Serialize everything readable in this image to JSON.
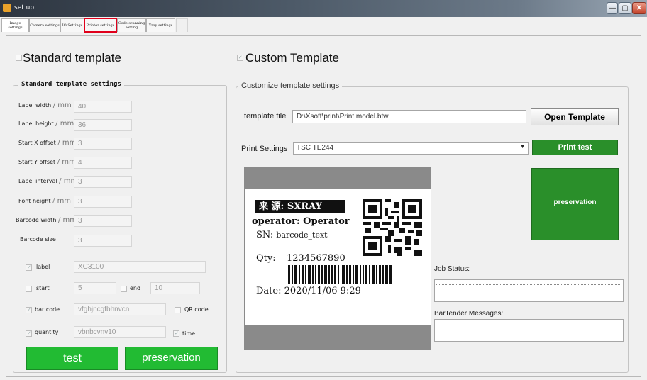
{
  "window": {
    "title": "set up"
  },
  "titlebar_buttons": {
    "minimize": "—",
    "maximize": "▢",
    "close": "✕"
  },
  "tabs": [
    {
      "label": "Image settings"
    },
    {
      "label": "Camera settings"
    },
    {
      "label": "IO Settings"
    },
    {
      "label": "Printer settings"
    },
    {
      "label": "Code scanning setting"
    },
    {
      "label": "Xray settings"
    }
  ],
  "standard": {
    "radio_label": "Standard template",
    "group_title": "Standard template settings",
    "fields": [
      {
        "label": "Label width",
        "unit": "/ mm",
        "value": "40"
      },
      {
        "label": "Label height",
        "unit": "/ mm",
        "value": "36"
      },
      {
        "label": "Start X offset",
        "unit": "/ mm",
        "value": "3"
      },
      {
        "label": "Start Y offset",
        "unit": "/ mm",
        "value": "4"
      },
      {
        "label": "Label interval",
        "unit": "/ mm",
        "value": "3"
      },
      {
        "label": "Font height",
        "unit": "/ mm",
        "value": "3"
      },
      {
        "label": "Barcode width",
        "unit": "/ mm",
        "value": "3"
      },
      {
        "label": "Barcode size",
        "unit": "",
        "value": "3"
      }
    ],
    "checks": {
      "label": {
        "text": "label",
        "value": "XC3100"
      },
      "start": {
        "text": "start",
        "value": "5"
      },
      "end": {
        "text": "end",
        "value": "10"
      },
      "bar_code": {
        "text": "bar code",
        "value": "vfghjncgfbhnvcn"
      },
      "qr_code": {
        "text": "QR code"
      },
      "quantity": {
        "text": "quantity",
        "value": "vbnbcvnv10"
      },
      "time": {
        "text": "time"
      }
    },
    "test_button": "test",
    "save_button": "preservation"
  },
  "custom": {
    "radio_label": "Custom Template",
    "group_title": "Customize template settings",
    "template_file_label": "template file",
    "template_file_value": "D:\\Xsoft\\print\\Print model.btw",
    "open_template_button": "Open Template",
    "print_settings_label": "Print Settings",
    "printer_value": "TSC TE244",
    "print_test_button": "Print test",
    "preservation_button": "preservation",
    "job_status_label": "Job Status:",
    "bartender_label": "BarTender Messages:"
  },
  "preview": {
    "source_prefix": "来  源:",
    "source_value": "SXRAY",
    "operator_label": "operator:",
    "operator_value": "Operator",
    "sn_label": "SN:",
    "sn_value": "barcode_text",
    "qty_label": "Qty:",
    "qty_value": "1234567890",
    "date_label": "Date:",
    "date_value": "2020/11/06 9:29"
  },
  "colors": {
    "green": "#22bb33",
    "dark_green": "#2a8f2a",
    "tab_highlight": "#e0001b"
  }
}
